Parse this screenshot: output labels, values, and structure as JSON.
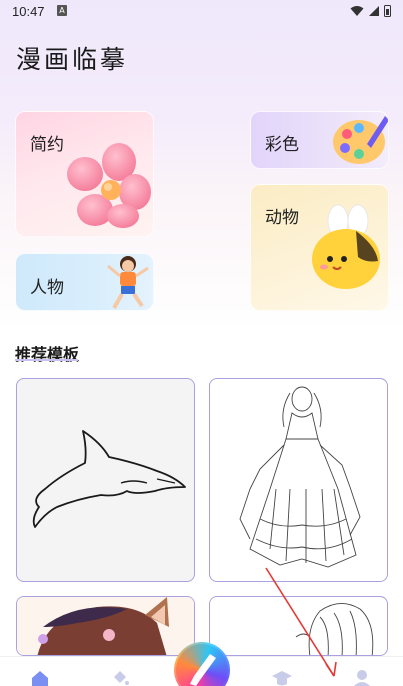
{
  "status_bar": {
    "time": "10:47",
    "notif_letter": "A"
  },
  "app": {
    "title": "漫画临摹"
  },
  "categories": {
    "jianyue": "简约",
    "caise": "彩色",
    "dongwu": "动物",
    "renwu": "人物"
  },
  "section": {
    "recommended_title": "推荐模板"
  },
  "colors": {
    "accent": "#a9a1e0",
    "annotation_arrow": "#e53935"
  },
  "bottom_nav": {
    "items": [
      "home-icon",
      "paint-bucket-icon",
      "brush-icon",
      "graduation-cap-icon",
      "user-icon"
    ]
  }
}
